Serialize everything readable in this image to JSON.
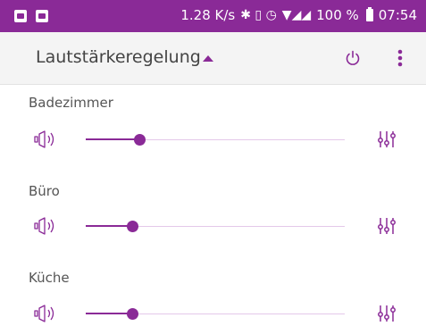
{
  "status_bar": {
    "speed": "1.28 K/s",
    "glyphs": "✱ ▯ ◷",
    "signal_glyphs": "▼◢◢",
    "battery": "100 %",
    "time": "07:54"
  },
  "app_bar": {
    "title": "Lautstärkeregelung",
    "icons": [
      "caret-up-icon",
      "power-icon",
      "more-vert-icon"
    ]
  },
  "rooms": [
    {
      "name": "Badezimmer",
      "volume_fraction": 0.21
    },
    {
      "name": "Büro",
      "volume_fraction": 0.18
    },
    {
      "name": "Küche",
      "volume_fraction": 0.18
    }
  ],
  "colors": {
    "accent": "#8a2a97",
    "track": "#e4c8ea",
    "appbar": "#f4f4f4",
    "statusbar": "#8a2a97"
  }
}
